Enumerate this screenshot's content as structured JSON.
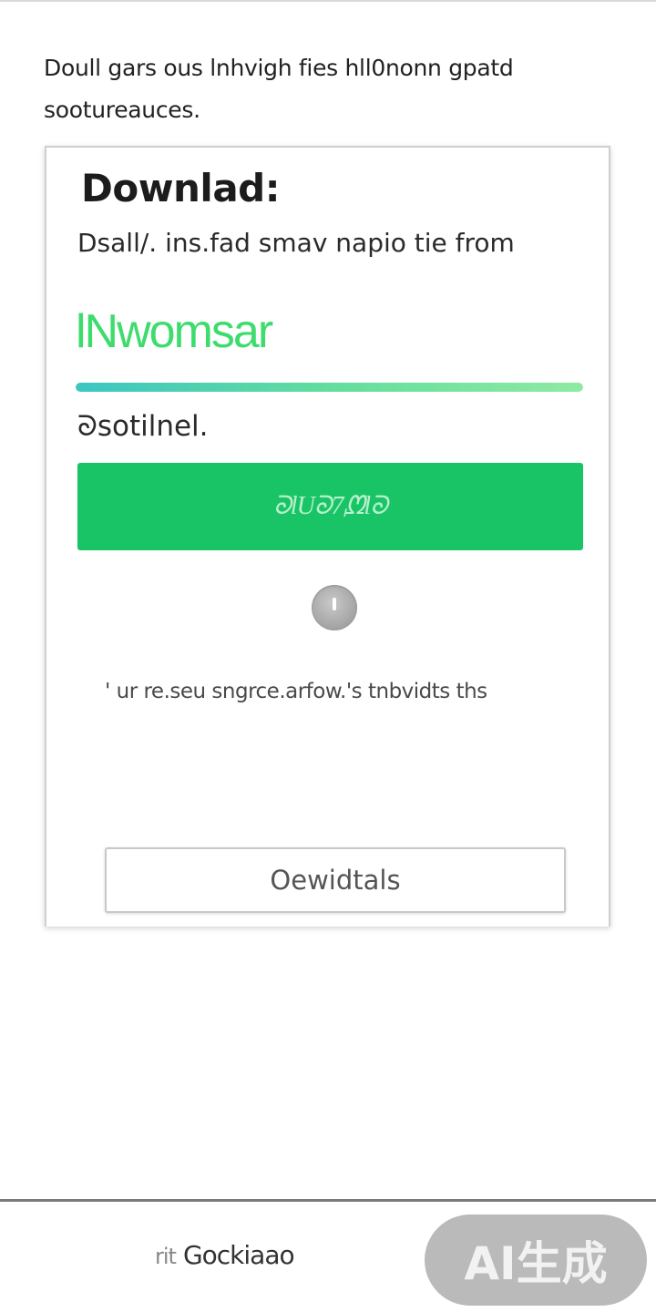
{
  "intro": {
    "line1": "Doull gars ous lnhvigh fies  hll0nonn gpatd",
    "line2": "sootureauces."
  },
  "card": {
    "title": "Downlad:",
    "subtitle": "Dsall/. ins.fad smav napio tie from",
    "green_text": "lNwomsar",
    "progress_percent": 100,
    "status_label": "ᘐsotilnel.",
    "primary_button_label": "ᘐlUᘐ7ᘻlᘐ",
    "note_text": "' ur re.seu sngrce.arfow.'s tnbvidts ths",
    "secondary_button_label": "Oewidtals"
  },
  "bottom_bar": {
    "link_prefix": "rit",
    "link_label": "Gockiaao",
    "ai_badge": "AI生成"
  },
  "colors": {
    "primary_green": "#19c466",
    "text_green": "#3ddc6c",
    "progress_start": "#3cc6c2",
    "progress_end": "#8eeaa2"
  },
  "icons": {
    "spinner": "loading-spinner-icon"
  }
}
